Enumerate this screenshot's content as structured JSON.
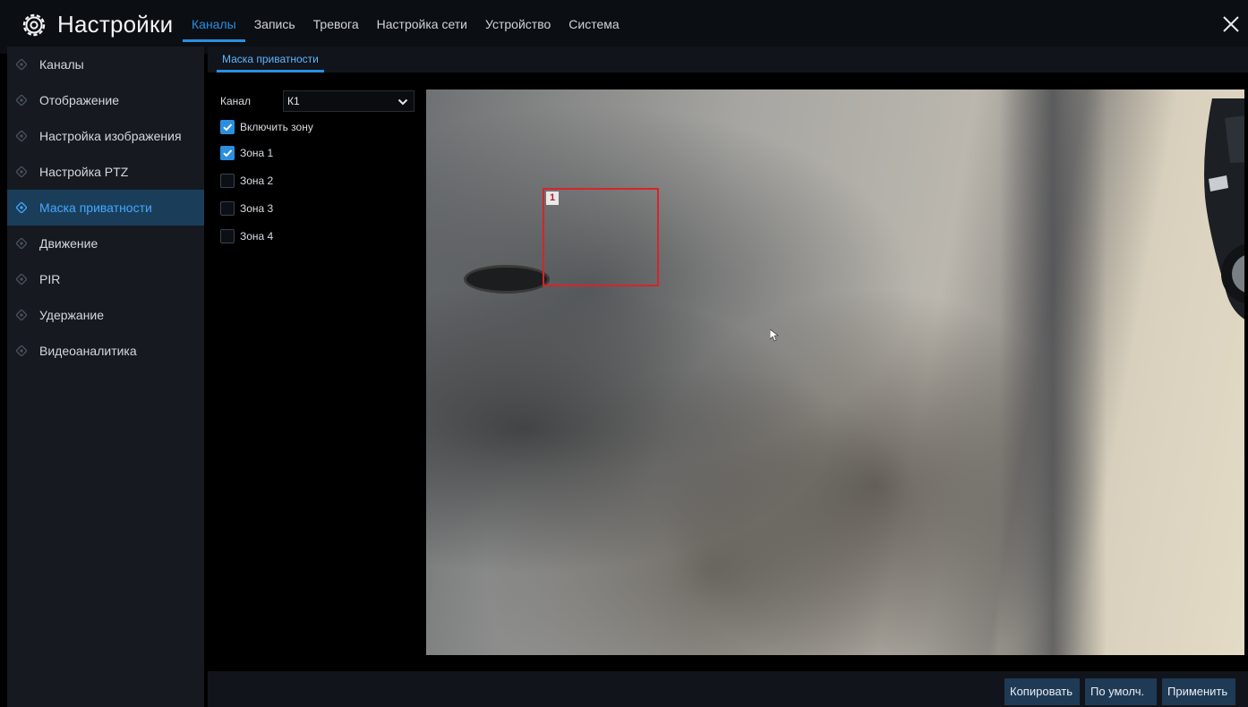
{
  "header": {
    "title": "Настройки",
    "tabs": [
      {
        "label": "Каналы",
        "active": true
      },
      {
        "label": "Запись",
        "active": false
      },
      {
        "label": "Тревога",
        "active": false
      },
      {
        "label": "Настройка сети",
        "active": false
      },
      {
        "label": "Устройство",
        "active": false
      },
      {
        "label": "Система",
        "active": false
      }
    ],
    "close_icon": "close-icon",
    "settings_icon": "gear-icon"
  },
  "sidebar": {
    "items": [
      {
        "label": "Каналы",
        "active": false
      },
      {
        "label": "Отображение",
        "active": false
      },
      {
        "label": "Настройка изображения",
        "active": false
      },
      {
        "label": "Настройка PTZ",
        "active": false
      },
      {
        "label": "Маска приватности",
        "active": true
      },
      {
        "label": "Движение",
        "active": false
      },
      {
        "label": "PIR",
        "active": false
      },
      {
        "label": "Удержание",
        "active": false
      },
      {
        "label": "Видеоаналитика",
        "active": false
      }
    ]
  },
  "subtab": {
    "label": "Маска приватности"
  },
  "form": {
    "channel_label": "Канал",
    "channel_value": "К1",
    "checkboxes": [
      {
        "label": "Включить зону",
        "checked": true
      },
      {
        "label": "Зона 1",
        "checked": true
      },
      {
        "label": "Зона 2",
        "checked": false
      },
      {
        "label": "Зона 3",
        "checked": false
      },
      {
        "label": "Зона 4",
        "checked": false
      }
    ]
  },
  "preview": {
    "zones": [
      {
        "label": "1"
      }
    ]
  },
  "footer": {
    "copy_label": "Копировать",
    "default_label": "По умолч.",
    "apply_label": "Применить"
  },
  "colors": {
    "accent": "#2a8fe0",
    "active_bg": "#1a3e5a",
    "zone_border": "#d8232a",
    "button_bg": "#1f3a55"
  }
}
